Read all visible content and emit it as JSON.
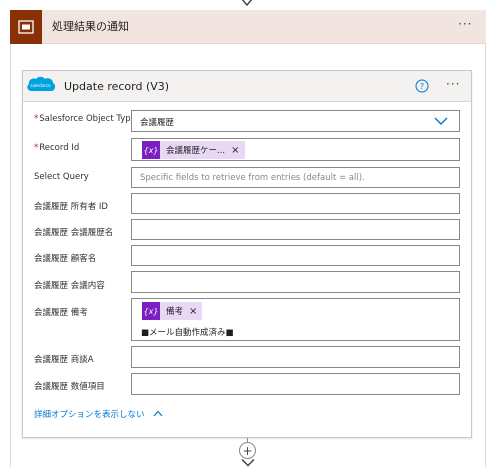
{
  "scope": {
    "title": "処理結果の通知",
    "more_label": "···"
  },
  "card": {
    "logo_text": "salesforce",
    "title": "Update record (V3)",
    "help_label": "?",
    "more_label": "···"
  },
  "fields": {
    "object_type": {
      "label": "Salesforce Object Type",
      "required_mark": "*",
      "value": "会議履歴"
    },
    "record_id": {
      "label": "Record Id",
      "required_mark": "*",
      "token_icon": "{x}",
      "token_label": "会議履歴ケー...",
      "token_remove": "×"
    },
    "select_query": {
      "label": "Select Query",
      "placeholder": "Specific fields to retrieve from entries (default = all)."
    },
    "owner_id": {
      "label": "会議履歴 所有者 ID"
    },
    "name": {
      "label": "会議履歴 会議履歴名"
    },
    "customer": {
      "label": "会議履歴 顧客名"
    },
    "content": {
      "label": "会議履歴 会議内容"
    },
    "notes": {
      "label": "会議履歴 備考",
      "token_icon": "{x}",
      "token_label": "備考",
      "token_remove": "×",
      "value": "■メール自動作成済み■"
    },
    "deal": {
      "label": "会議履歴 商談A"
    },
    "number_item": {
      "label": "会議履歴 数値項目"
    }
  },
  "advanced_link": {
    "label": "詳細オプションを表示しない",
    "chevron": "^"
  },
  "connector": {
    "plus_label": "+"
  },
  "colors": {
    "scope_header_bg": "#f2e4e0",
    "scope_icon_bg": "#8a3007",
    "token_bg": "#e8d8f5",
    "token_icon_bg": "#7a1fc0",
    "link": "#0078d4",
    "salesforce_blue": "#00a1e0",
    "required": "#a4262c"
  }
}
